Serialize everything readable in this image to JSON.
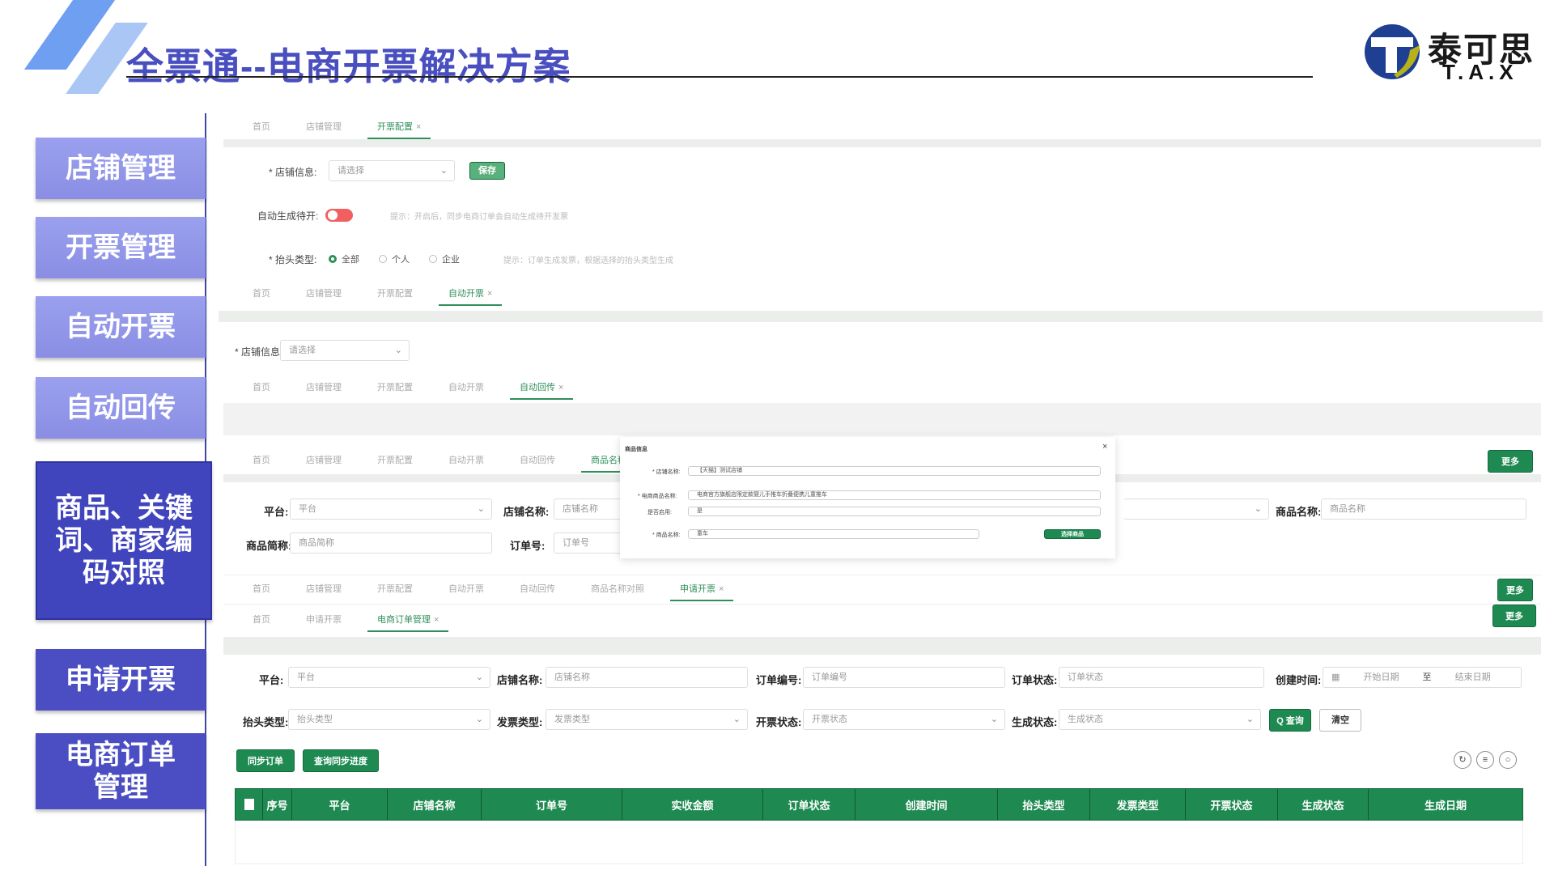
{
  "header": {
    "title": "全票通--电商开票解决方案",
    "logo_cn": "泰可思",
    "logo_en": "T.A.X"
  },
  "menu": [
    "店铺管理",
    "开票管理",
    "自动开票",
    "自动回传",
    "商品、关键词、商家编码对照",
    "申请开票",
    "电商订单管理"
  ],
  "shop_config": {
    "tabs": [
      "首页",
      "店铺管理",
      "开票配置"
    ],
    "store_label": "* 店铺信息:",
    "store_placeholder": "请选择",
    "save": "保存",
    "auto_label": "自动生成待开:",
    "auto_hint": "提示：开启后，同步电商订单会自动生成待开发票",
    "title_type_label": "* 抬头类型:",
    "title_types": [
      "全部",
      "个人",
      "企业"
    ],
    "title_hint": "提示：订单生成发票，根据选择的抬头类型生成"
  },
  "auto_invoice": {
    "tabs": [
      "首页",
      "店铺管理",
      "开票配置",
      "自动开票"
    ],
    "store_label": "* 店铺信息",
    "store_placeholder": "请选择"
  },
  "auto_return": {
    "tabs": [
      "首页",
      "店铺管理",
      "开票配置",
      "自动开票",
      "自动回传"
    ]
  },
  "mapping": {
    "tabs": [
      "首页",
      "店铺管理",
      "开票配置",
      "自动开票",
      "自动回传",
      "商品名称对照"
    ],
    "more": "更多",
    "platform_label": "平台:",
    "platform_placeholder": "平台",
    "store_label": "店铺名称:",
    "store_placeholder": "店铺名称",
    "goods_name_label": "商品名称:",
    "goods_name_placeholder": "商品名称",
    "goods_short_label": "商品简称:",
    "goods_short_placeholder": "商品简称",
    "order_label": "订单号:",
    "order_placeholder": "订单号",
    "dialog": {
      "title": "商品信息",
      "close": "×",
      "rows": [
        {
          "label": "* 店铺名称:",
          "value": "【天猫】测试店铺"
        },
        {
          "label": "* 电商商品名称:",
          "value": "电商官方旗舰店限定款婴儿手推车折叠便携儿童推车"
        },
        {
          "label": "是否启用:",
          "value": "是"
        },
        {
          "label": "* 商品名称:",
          "value": "童车"
        }
      ],
      "select_button": "选择商品"
    }
  },
  "apply": {
    "tabs": [
      "首页",
      "店铺管理",
      "开票配置",
      "自动开票",
      "自动回传",
      "商品名称对照",
      "申请开票"
    ],
    "more": "更多"
  },
  "orders": {
    "tabs": [
      "首页",
      "申请开票",
      "电商订单管理"
    ],
    "more": "更多",
    "filters_row1": [
      {
        "label": "平台:",
        "placeholder": "平台"
      },
      {
        "label": "店铺名称:",
        "placeholder": "店铺名称"
      },
      {
        "label": "订单编号:",
        "placeholder": "订单编号"
      },
      {
        "label": "订单状态:",
        "placeholder": "订单状态"
      }
    ],
    "created_label": "创建时间:",
    "start_date": "开始日期",
    "date_sep": "至",
    "end_date": "结束日期",
    "filters_row2": [
      {
        "label": "抬头类型:",
        "placeholder": "抬头类型"
      },
      {
        "label": "发票类型:",
        "placeholder": "发票类型"
      },
      {
        "label": "开票状态:",
        "placeholder": "开票状态"
      },
      {
        "label": "生成状态:",
        "placeholder": "生成状态"
      }
    ],
    "search": "Q 查询",
    "reset": "清空",
    "sync_orders": "同步订单",
    "sync_progress": "查询同步进度",
    "columns": [
      "序号",
      "平台",
      "店铺名称",
      "订单号",
      "实收金额",
      "订单状态",
      "创建时间",
      "抬头类型",
      "发票类型",
      "开票状态",
      "生成状态",
      "生成日期"
    ]
  },
  "colors": {
    "accent_green": "#1e8a51",
    "menu_purple": "#8a8ee4",
    "menu_dark": "#4a4ec2",
    "title": "#4a4fc0"
  }
}
